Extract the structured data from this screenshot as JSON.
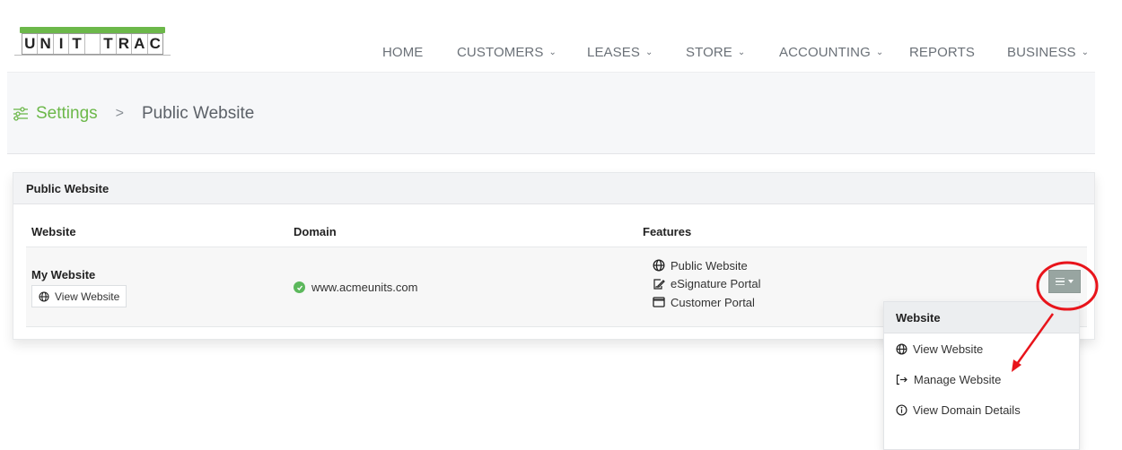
{
  "logo": {
    "letters": [
      "U",
      "N",
      "I",
      "T",
      "",
      "T",
      "R",
      "A",
      "C"
    ],
    "brand_color": "#6cb84a"
  },
  "nav": {
    "items": [
      {
        "label": "HOME",
        "has_dropdown": false
      },
      {
        "label": "CUSTOMERS",
        "has_dropdown": true
      },
      {
        "label": "LEASES",
        "has_dropdown": true
      },
      {
        "label": "STORE",
        "has_dropdown": true
      },
      {
        "label": "ACCOUNTING",
        "has_dropdown": true
      },
      {
        "label": "REPORTS",
        "has_dropdown": false
      },
      {
        "label": "BUSINESS",
        "has_dropdown": true
      }
    ],
    "chevron": "⌄"
  },
  "breadcrumb": {
    "icon": "sliders-icon",
    "root": "Settings",
    "separator": ">",
    "current": "Public Website"
  },
  "card": {
    "title": "Public Website",
    "columns": [
      "Website",
      "Domain",
      "Features"
    ],
    "rows": [
      {
        "website": "My Website",
        "view_button": "View Website",
        "domain": "www.acmeunits.com",
        "domain_status": "verified",
        "features": [
          {
            "icon": "globe-icon",
            "label": "Public Website"
          },
          {
            "icon": "signature-icon",
            "label": "eSignature Portal"
          },
          {
            "icon": "window-icon",
            "label": "Customer Portal"
          }
        ]
      }
    ]
  },
  "dropdown": {
    "header": "Website",
    "items": [
      {
        "icon": "globe-icon",
        "label": "View Website"
      },
      {
        "icon": "sign-in-icon",
        "label": "Manage Website"
      },
      {
        "icon": "info-icon",
        "label": "View Domain Details"
      }
    ]
  },
  "colors": {
    "accent": "#6cb84a",
    "success": "#5cb85c",
    "menu_button": "#98a5a1",
    "annotation": "#e8141b"
  }
}
